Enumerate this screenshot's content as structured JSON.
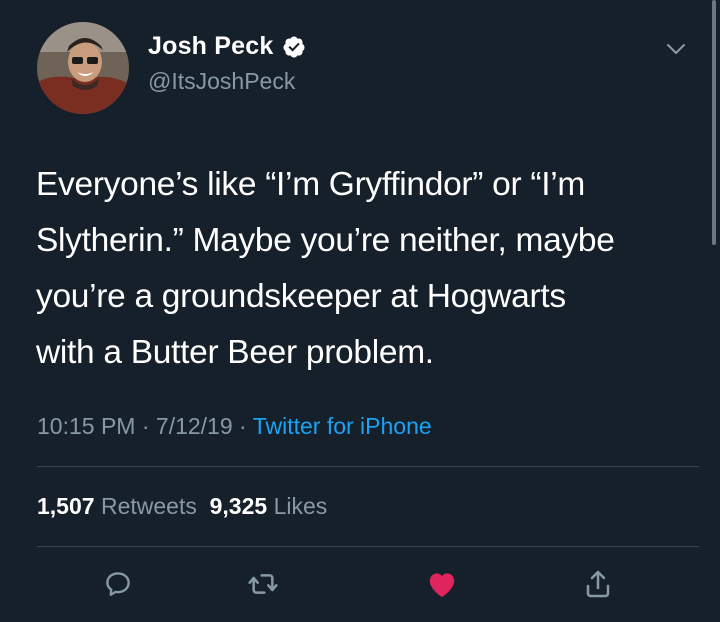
{
  "author": {
    "display_name": "Josh Peck",
    "handle": "@ItsJoshPeck",
    "verified": true
  },
  "tweet": {
    "text_lines": [
      "Everyone’s like “I’m Gryffindor” or “I’m",
      "Slytherin.” Maybe you’re neither, maybe",
      "you’re a groundskeeper at Hogwarts",
      "with a Butter Beer problem."
    ],
    "time": "10:15 PM",
    "date": "7/12/19",
    "separator": "·",
    "source": "Twitter for iPhone"
  },
  "stats": {
    "retweets_count": "1,507",
    "retweets_label": "Retweets",
    "likes_count": "9,325",
    "likes_label": "Likes"
  },
  "actions": [
    {
      "icon": "reply-icon"
    },
    {
      "icon": "retweet-icon"
    },
    {
      "icon": "like-icon",
      "liked": true
    },
    {
      "icon": "share-icon"
    }
  ],
  "colors": {
    "background": "#15202b",
    "text": "#ffffff",
    "secondary_text": "#8899a6",
    "link": "#1da1f2",
    "like": "#e0245e",
    "divider": "#38444d"
  }
}
